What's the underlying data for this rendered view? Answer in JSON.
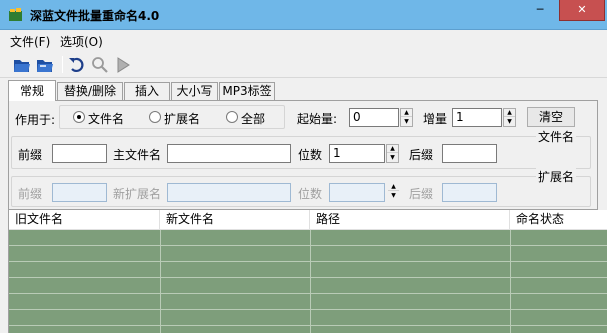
{
  "window": {
    "title": "深蓝文件批量重命名4.0",
    "close_glyph": "✕",
    "min_glyph": "─",
    "max_glyph": "☐"
  },
  "menu": {
    "items": [
      {
        "label": "文件(F)"
      },
      {
        "label": "选项(O)"
      }
    ]
  },
  "toolbar": {
    "icons": [
      "folder-open-icon",
      "folder-add-icon",
      "undo-icon",
      "search-icon",
      "run-icon"
    ]
  },
  "tabs": [
    {
      "label": "常规"
    },
    {
      "label": "替换/删除"
    },
    {
      "label": "插入"
    },
    {
      "label": "大小写"
    },
    {
      "label": "MP3标签"
    }
  ],
  "general": {
    "apply_to_label": "作用于:",
    "radios": [
      {
        "label": "文件名",
        "selected": true
      },
      {
        "label": "扩展名",
        "selected": false
      },
      {
        "label": "全部",
        "selected": false
      }
    ],
    "start_label": "起始量:",
    "start_value": "0",
    "increment_label": "增量",
    "increment_value": "1",
    "clear_label": "清空"
  },
  "filename_group": {
    "title": "文件名",
    "prefix_label": "前缀",
    "prefix_value": "",
    "main_label": "主文件名",
    "main_value": "",
    "digits_label": "位数",
    "digits_value": "1",
    "suffix_label": "后缀",
    "suffix_value": ""
  },
  "extension_group": {
    "title": "扩展名",
    "prefix_label": "前缀",
    "new_ext_label": "新扩展名",
    "digits_label": "位数",
    "suffix_label": "后缀"
  },
  "list": {
    "columns": [
      {
        "label": "旧文件名"
      },
      {
        "label": "新文件名"
      },
      {
        "label": "路径"
      },
      {
        "label": "命名状态"
      }
    ],
    "background": "#7e9e7b"
  }
}
